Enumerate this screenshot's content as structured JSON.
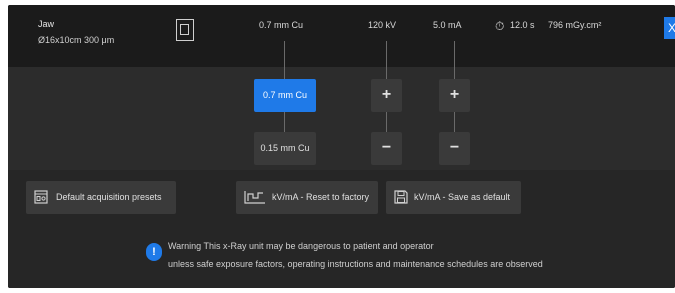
{
  "jaw": {
    "title": "Jaw",
    "size": "Ø16x10cm 300 μm"
  },
  "status": {
    "filter": "0.7 mm Cu",
    "kv": "120 kV",
    "ma": "5.0 mA",
    "time": "12.0 s",
    "dose": "796 mGy.cm²"
  },
  "controls": {
    "filter_selected": "0.7 mm Cu",
    "filter_option": "0.15 mm Cu",
    "kv_plus": "+",
    "kv_minus": "−",
    "ma_plus": "+",
    "ma_minus": "−"
  },
  "actions": {
    "presets": "Default acquisition presets",
    "reset": "kV/mA - Reset to factory",
    "save": "kV/mA - Save as default"
  },
  "warning": {
    "line1": "Warning This x-Ray unit may be dangerous to patient and operator",
    "line2": "unless safe exposure factors, operating instructions and maintenance schedules are observed"
  },
  "close_label": "X",
  "icons": {
    "collimator": "collimator-icon",
    "timer": "stopwatch-icon",
    "presets": "presets-icon",
    "reset": "chart-reset-icon",
    "save": "floppy-save-icon",
    "warning": "info-warning-icon"
  },
  "colors": {
    "accent": "#1f7ae8",
    "background": "#1c1c1c",
    "panel": "#262626",
    "button": "#3a3a3a"
  }
}
